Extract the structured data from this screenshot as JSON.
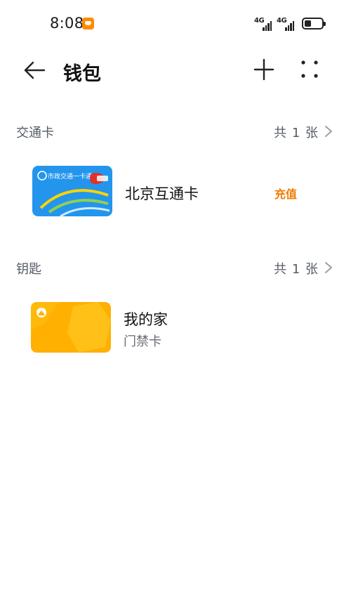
{
  "status_bar": {
    "time": "8:08",
    "network_1": "4G",
    "network_2": "4G",
    "icons": [
      "notification-app-icon",
      "signal-icon",
      "signal-icon",
      "battery-icon"
    ]
  },
  "header": {
    "title": "钱包",
    "icons": [
      "back-arrow-icon",
      "plus-icon",
      "more-dots-icon"
    ]
  },
  "sections": [
    {
      "title": "交通卡",
      "count": "共 1 张",
      "card": {
        "name": "北京互通卡",
        "action": "充值",
        "thumb_text": "市政交通一卡通",
        "thumb_color": "#1f8fe8"
      }
    },
    {
      "title": "钥匙",
      "count": "共 1 张",
      "card": {
        "name": "我的家",
        "subtitle": "门禁卡",
        "thumb_color": "#ffb000"
      }
    }
  ],
  "colors": {
    "accent_orange": "#f07d00",
    "section_text": "#555b66"
  }
}
